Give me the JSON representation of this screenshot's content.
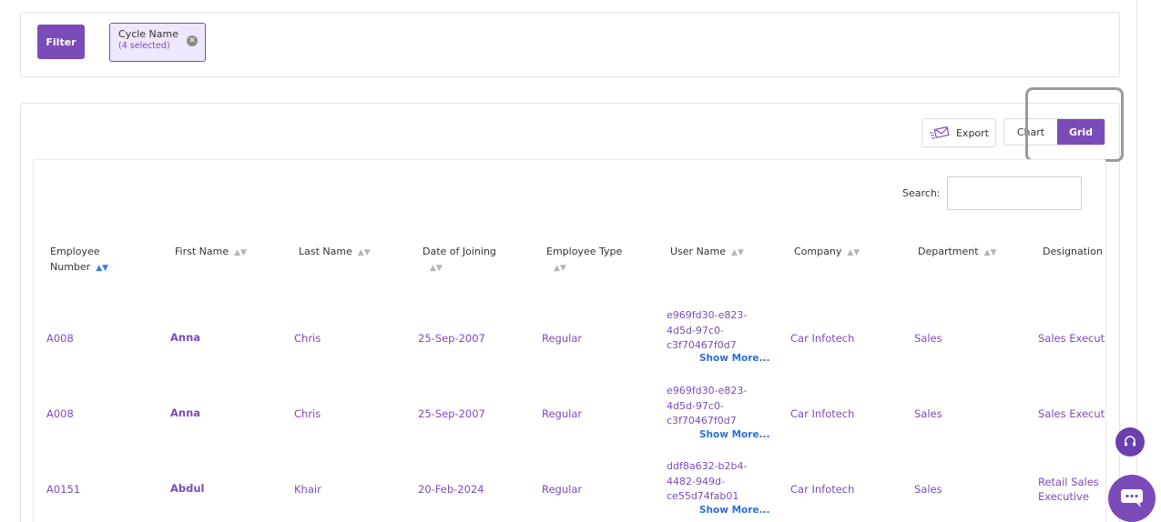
{
  "filter": {
    "button_label": "Filter",
    "chip": {
      "title": "Cycle Name",
      "subtitle": "(4 selected)"
    }
  },
  "toolbar": {
    "export_label": "Export",
    "chart_label": "Chart",
    "grid_label": "Grid",
    "active_view": "Grid"
  },
  "search": {
    "label": "Search:",
    "value": ""
  },
  "table": {
    "columns": [
      {
        "label": "Employee Number",
        "sorted": "asc"
      },
      {
        "label": "First Name"
      },
      {
        "label": "Last Name"
      },
      {
        "label": "Date of Joining"
      },
      {
        "label": "Employee Type"
      },
      {
        "label": "User Name"
      },
      {
        "label": "Company"
      },
      {
        "label": "Department"
      },
      {
        "label": "Designation"
      }
    ],
    "rows": [
      {
        "employee_number": "A008",
        "first_name": "Anna",
        "last_name": "Chris",
        "date_of_joining": "25-Sep-2007",
        "employee_type": "Regular",
        "user_name": [
          "e969fd30-e823-",
          "4d5d-97c0-",
          "c3f70467f0d7"
        ],
        "company": "Car Infotech",
        "department": "Sales",
        "designation": "Sales Executi"
      },
      {
        "employee_number": "A008",
        "first_name": "Anna",
        "last_name": "Chris",
        "date_of_joining": "25-Sep-2007",
        "employee_type": "Regular",
        "user_name": [
          "e969fd30-e823-",
          "4d5d-97c0-",
          "c3f70467f0d7"
        ],
        "company": "Car Infotech",
        "department": "Sales",
        "designation": "Sales Executi"
      },
      {
        "employee_number": "A0151",
        "first_name": "Abdul",
        "last_name": "Khair",
        "date_of_joining": "20-Feb-2024",
        "employee_type": "Regular",
        "user_name": [
          "ddf8a632-b2b4-",
          "4482-949d-",
          "ce55d74fab01"
        ],
        "company": "Car Infotech",
        "department": "Sales",
        "designation": [
          "Retail Sales",
          "Executive"
        ]
      }
    ],
    "show_more_label": "Show More..."
  },
  "colors": {
    "accent": "#7b4bb9",
    "link": "#2f6fcf",
    "chip_bg": "#efe7fb"
  },
  "icons": {
    "export": "envelope-icon",
    "chip_close": "close-circle-icon",
    "support": "headset-icon",
    "chat": "chat-icon"
  }
}
